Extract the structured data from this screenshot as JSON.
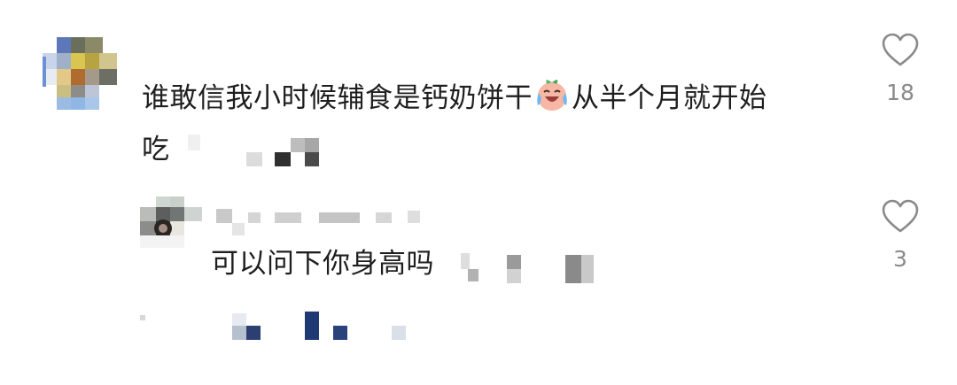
{
  "comments": [
    {
      "text_main": "谁敢信我小时候辅食是钙奶饼干",
      "emoji": "crying-laughing-peach-emoji",
      "text_tail": "从半个月就开始",
      "text_line2": "吃",
      "likes": "18"
    }
  ],
  "reply": {
    "text": "可以问下你身高吗",
    "likes": "3"
  },
  "colors": {
    "text": "#1f1f1f",
    "count": "#8a8a8a",
    "heart": "#8a8a8a"
  },
  "icons": [
    "heart-outline-icon"
  ]
}
